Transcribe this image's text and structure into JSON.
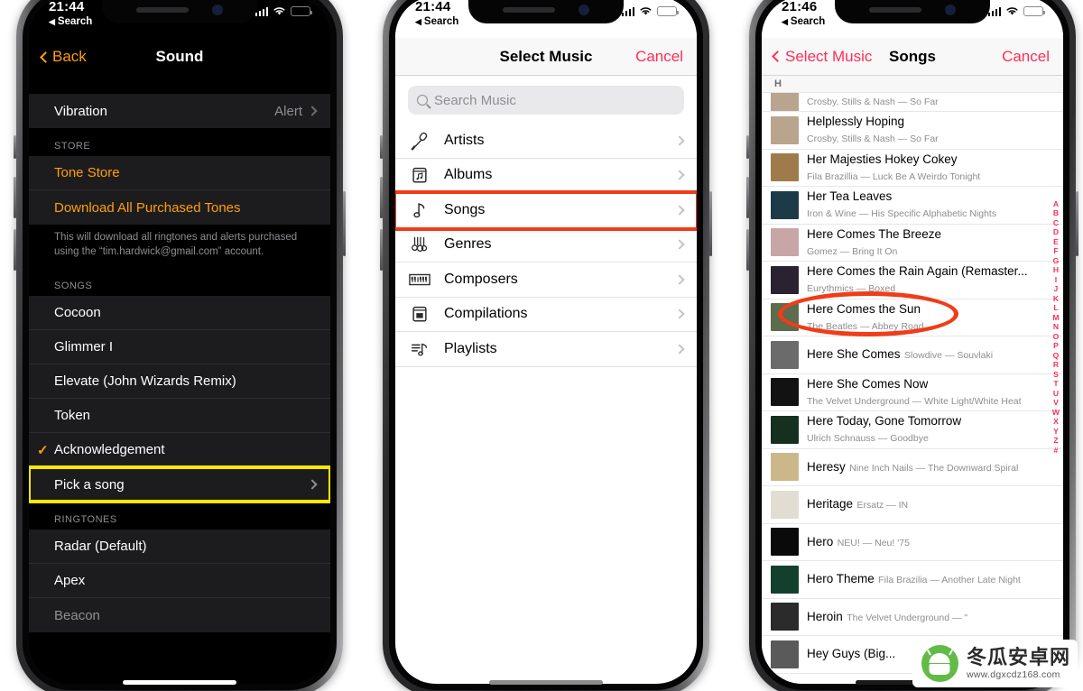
{
  "background_color": "#ffffff",
  "accent_colors": {
    "ios_orange": "#FF9F0A",
    "ios_pink": "#FF2D55",
    "highlight_yellow": "#FFE800",
    "highlight_red": "#F03C18",
    "dark_row": "#1c1c1e",
    "dark_bg": "#000000"
  },
  "phone1": {
    "status": {
      "time": "21:44",
      "back_label": "Search",
      "battery": "82%"
    },
    "nav": {
      "back": "Back",
      "title": "Sound"
    },
    "vibration_row": {
      "label": "Vibration",
      "value": "Alert"
    },
    "store": {
      "header": "STORE",
      "items": [
        "Tone Store",
        "Download All Purchased Tones"
      ],
      "footer": "This will download all ringtones and alerts purchased using the “tim.hardwick@gmail.com” account."
    },
    "songs": {
      "header": "SONGS",
      "items": [
        {
          "label": "Cocoon",
          "checked": false,
          "chevron": false
        },
        {
          "label": "Glimmer I",
          "checked": false,
          "chevron": false
        },
        {
          "label": "Elevate (John Wizards Remix)",
          "checked": false,
          "chevron": false
        },
        {
          "label": "Token",
          "checked": false,
          "chevron": false
        },
        {
          "label": "Acknowledgement",
          "checked": true,
          "chevron": false
        },
        {
          "label": "Pick a song",
          "checked": false,
          "chevron": true,
          "highlight": "yellow"
        }
      ]
    },
    "ringtones": {
      "header": "RINGTONES",
      "items": [
        "Radar (Default)",
        "Apex",
        "Beacon"
      ]
    }
  },
  "phone2": {
    "status": {
      "time": "21:44",
      "back_label": "Search",
      "battery": "82%"
    },
    "nav": {
      "title": "Select Music",
      "cancel": "Cancel"
    },
    "search": {
      "placeholder": "Search Music"
    },
    "categories": [
      {
        "label": "Artists",
        "icon": "microphone-icon"
      },
      {
        "label": "Albums",
        "icon": "album-icon"
      },
      {
        "label": "Songs",
        "icon": "music-note-icon",
        "highlight": "red"
      },
      {
        "label": "Genres",
        "icon": "guitars-icon"
      },
      {
        "label": "Composers",
        "icon": "piano-icon"
      },
      {
        "label": "Compilations",
        "icon": "compilation-icon"
      },
      {
        "label": "Playlists",
        "icon": "playlist-icon"
      }
    ]
  },
  "phone3": {
    "status": {
      "time": "21:46",
      "back_label": "Search",
      "battery": "82%"
    },
    "nav": {
      "back": "Select Music",
      "title": "Songs",
      "cancel": "Cancel"
    },
    "section_header": "H",
    "index_letters": [
      "A",
      "B",
      "C",
      "D",
      "E",
      "F",
      "G",
      "H",
      "I",
      "J",
      "K",
      "L",
      "M",
      "N",
      "O",
      "P",
      "Q",
      "R",
      "S",
      "T",
      "U",
      "V",
      "W",
      "X",
      "Y",
      "Z",
      "#"
    ],
    "partial_top_row": {
      "title": "",
      "subtitle": "Crosby, Stills & Nash — So Far"
    },
    "songs": [
      {
        "title": "Helplessly Hoping",
        "subtitle": "Crosby, Stills & Nash — So Far",
        "art": "#b9a48e"
      },
      {
        "title": "Her Majesties Hokey Cokey",
        "subtitle": "Fila Brazillia — Luck Be A Weirdo Tonight",
        "art": "#9f7a4a"
      },
      {
        "title": "Her Tea Leaves",
        "subtitle": "Iron & Wine — His Specific Alphabetic Nights",
        "art": "#1d3a49"
      },
      {
        "title": "Here Comes The Breeze",
        "subtitle": "Gomez — Bring It On",
        "art": "#c9a6a6"
      },
      {
        "title": "Here Comes the Rain Again (Remaster...",
        "subtitle": "Eurythmics — Boxed",
        "art": "#2a2230"
      },
      {
        "title": "Here Comes the Sun",
        "subtitle": "The Beatles — Abbey Road",
        "art": "#5d6b4e",
        "highlight": "ellipse"
      },
      {
        "title": "Here She Comes",
        "subtitle": "Slowdive — Souvlaki",
        "art": "#6b6b6b"
      },
      {
        "title": "Here She Comes Now",
        "subtitle": "The Velvet Underground — White Light/White Heat",
        "art": "#121212"
      },
      {
        "title": "Here Today, Gone Tomorrow",
        "subtitle": "Ulrich Schnauss — Goodbye",
        "art": "#16301f"
      },
      {
        "title": "Heresy",
        "subtitle": "Nine Inch Nails — The Downward Spiral",
        "art": "#cbb88a"
      },
      {
        "title": "Heritage",
        "subtitle": "Ersatz — IN",
        "art": "#e2ddd2"
      },
      {
        "title": "Hero",
        "subtitle": "NEU! — Neu! '75",
        "art": "#0a0a0a"
      },
      {
        "title": "Hero Theme",
        "subtitle": "Fila Brazilia — Another Late Night",
        "art": "#13402c"
      },
      {
        "title": "Heroin",
        "subtitle": "The Velvet Underground — \"",
        "art": "#2b2b2b"
      },
      {
        "title": "Hey Guys (Big...",
        "subtitle": "",
        "art": "#5a5a5a"
      }
    ]
  },
  "watermark": {
    "cn_text": "冬瓜安卓网",
    "url": "www.dgxcdz168.com"
  }
}
